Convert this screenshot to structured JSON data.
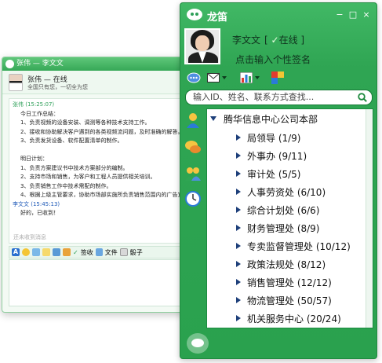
{
  "chat_window": {
    "title": "张伟 — 李文文",
    "contact_name": "张伟 — 在线",
    "contact_signature": "全国只有您，一切全为您",
    "messages": [
      {
        "header": "张伟  (15:25:07)",
        "lines": [
          "今日工作总结：",
          "1、负责视频的设备安装、调测等各种技术支持工作。",
          "2、接收和协助解决客户遇到的各类视频流问题，及时准确的解答。",
          "3、负责发货设备、软件配置清单的制作。",
          "",
          "明日计划：",
          "1、负责方案建议书中技术方案部分的编制。",
          "2、支持市场和销售，为客户和工程人员提供相关培训。",
          "3、负责销售工作中技术需配的制作。",
          "4、根据上级主管要求，协助市场部实施所负责销售范围内的广告宣传。"
        ]
      },
      {
        "header": "李文文  (15:45:13)",
        "lines": [
          "好的，已收到！"
        ]
      }
    ],
    "hint": "还未收到消息",
    "toolbar": {
      "sign_label": "签收",
      "file_label": "文件",
      "dice_label": "骰子"
    }
  },
  "main_window": {
    "app_name": "龙笛",
    "window_buttons": [
      "−",
      "□",
      "×"
    ],
    "user": {
      "name": "李文文",
      "status_open": "[",
      "status_check": "✓",
      "status": "在线",
      "status_close": "]",
      "signature": "点击输入个性签名"
    },
    "toolbar_icons": [
      "chat-bubble-icon",
      "mail-icon",
      "chart-icon",
      "app-puzzle-icon"
    ],
    "search": {
      "placeholder": "输入ID、姓名、联系方式查找..."
    },
    "sidebar_icons": [
      "contacts-icon",
      "messages-icon",
      "groups-icon",
      "history-icon"
    ],
    "tree": {
      "root": "腾华信息中心公司本部",
      "items": [
        {
          "label": "局领导 (1/9)"
        },
        {
          "label": "外事办 (9/11)"
        },
        {
          "label": "审计处 (5/5)"
        },
        {
          "label": "人事劳资处 (6/10)"
        },
        {
          "label": "综合计划处 (6/6)"
        },
        {
          "label": "财务管理处 (8/9)"
        },
        {
          "label": "专卖监督管理处 (10/12)"
        },
        {
          "label": "政策法规处 (8/12)"
        },
        {
          "label": "销售管理处 (12/12)"
        },
        {
          "label": "物流管理处 (50/57)"
        },
        {
          "label": "机关服务中心 (20/24)"
        }
      ]
    }
  },
  "colors": {
    "brand_green": "#2fa553",
    "dark_green": "#1f8a3f",
    "caret_blue": "#1d3f7a"
  }
}
